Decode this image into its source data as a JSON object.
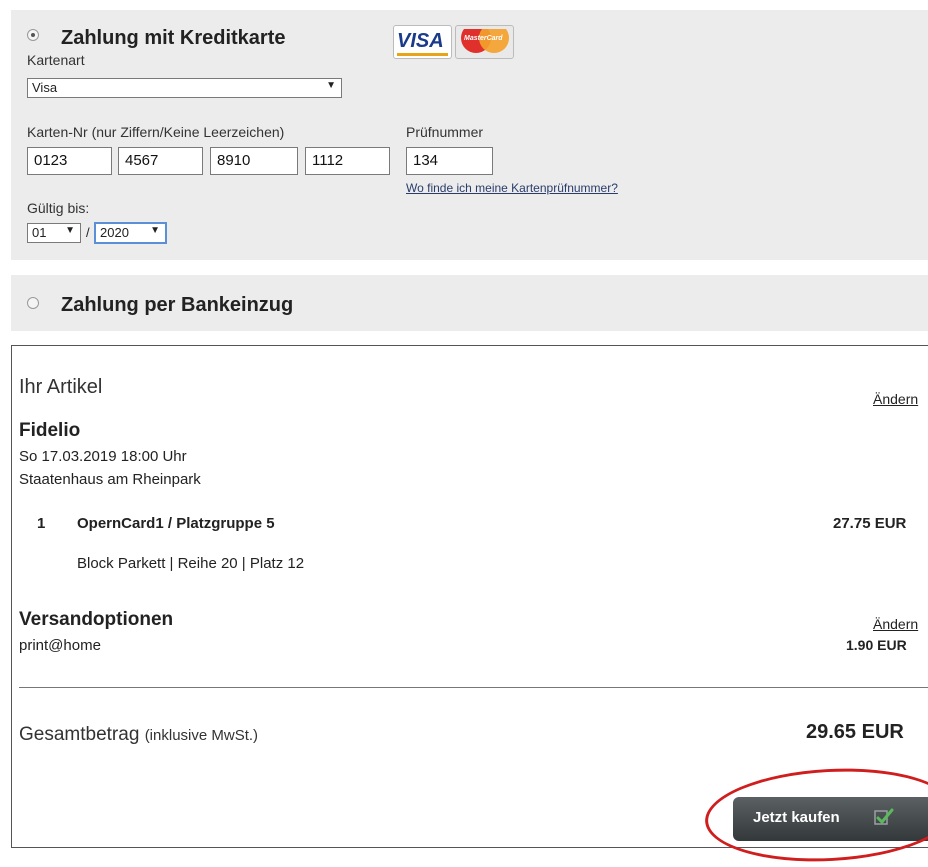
{
  "credit_card": {
    "heading": "Zahlung mit Kreditkarte",
    "selected": true,
    "card_type_label": "Kartenart",
    "card_type_value": "Visa",
    "logos": [
      "VISA",
      "MasterCard"
    ],
    "card_number_label": "Karten-Nr (nur Ziffern/Keine Leerzeichen)",
    "card_number_parts": [
      "0123",
      "4567",
      "8910",
      "1112"
    ],
    "cvc_label": "Prüfnummer",
    "cvc_value": "134",
    "cvc_help_link": "Wo finde ich meine Kartenprüfnummer?",
    "valid_label": "Gültig bis:",
    "month": "01",
    "separator": "/",
    "year": "2020"
  },
  "bank": {
    "heading": "Zahlung per Bankeinzug",
    "selected": false
  },
  "order": {
    "title": "Ihr Artikel",
    "change_label": "Ändern",
    "event_name": "Fidelio",
    "event_date": "So 17.03.2019 18:00 Uhr",
    "venue": "Staatenhaus am Rheinpark",
    "item_qty": "1",
    "item_name": "OpernCard1 / Platzgruppe 5",
    "item_price": "27.75 EUR",
    "item_seat": "Block Parkett | Reihe 20 | Platz 12",
    "shipping_title": "Versandoptionen",
    "shipping_change": "Ändern",
    "shipping_method": "print@home",
    "shipping_price": "1.90 EUR",
    "total_label": "Gesamtbetrag",
    "total_note": "(inklusive MwSt.)",
    "total_value": "29.65 EUR",
    "buy_button": "Jetzt kaufen"
  },
  "colors": {
    "panel_bg": "#ececec",
    "button_bg": "#3f4447",
    "annotation_red": "#d01d1d",
    "check_green": "#5cb85c"
  }
}
